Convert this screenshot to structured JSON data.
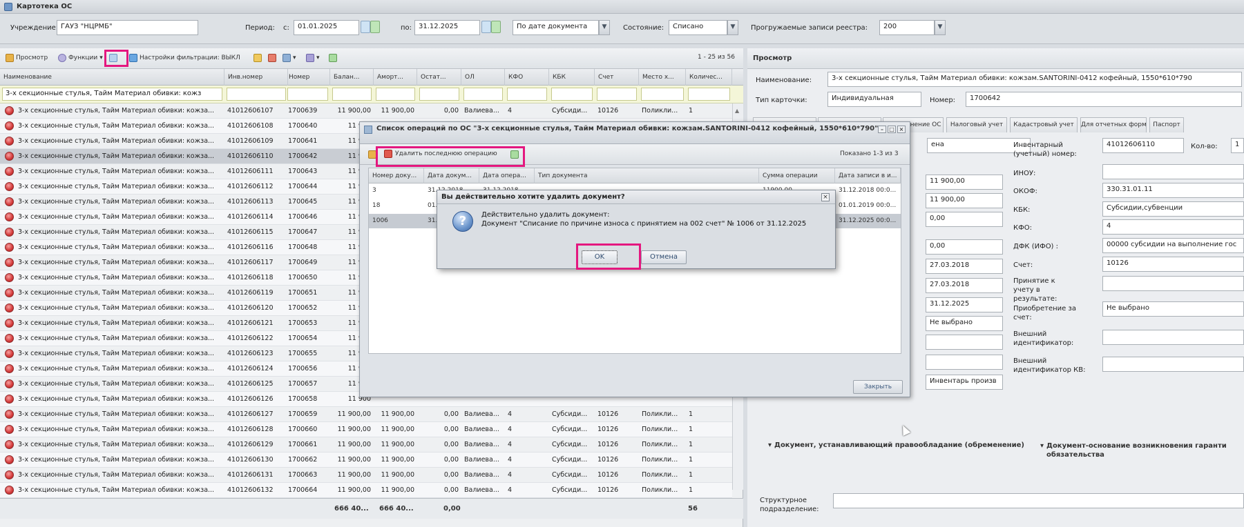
{
  "window": {
    "title": "Картотека ОС"
  },
  "filters": {
    "institution_label": "Учреждение:",
    "institution_value": "ГАУЗ \"НЦРМБ\"",
    "period_label": "Период:",
    "from_label": "с:",
    "from_value": "01.01.2025",
    "to_label": "по:",
    "to_value": "31.12.2025",
    "date_mode": "По дате документа",
    "state_label": "Состояние:",
    "state_value": "Списано",
    "loaded_label": "Прогружаемые записи реестра:",
    "loaded_value": "200"
  },
  "toolbar": {
    "view": "Просмотр",
    "functions": "Функции",
    "filter_settings": "Настройки фильтрации: ВЫКЛ",
    "pager": "1 - 25 из 56"
  },
  "columns": [
    "Наименование",
    "Инв.номер",
    "Номер",
    "Балан...",
    "Аморт...",
    "Остат...",
    "ОЛ",
    "КФО",
    "КБК",
    "Счет",
    "Место х...",
    "Количес..."
  ],
  "filter_row": {
    "name": "3-х секционные стулья, Тайм  Материал обивки: кожз"
  },
  "rows": [
    {
      "name": "3-х секционные стулья, Тайм Материал обивки: кожза...",
      "inv": "41012606107",
      "num": "1700639",
      "bal": "11 900,00",
      "amort": "11 900,00",
      "rest": "0,00",
      "ol": "Валиева...",
      "kfo": "4",
      "kbk": "Субсиди...",
      "acc": "10126",
      "place": "Поликли...",
      "qty": "1"
    },
    {
      "name": "3-х секционные стулья, Тайм Материал обивки: кожза...",
      "inv": "41012606108",
      "num": "1700640",
      "bal": "11 900"
    },
    {
      "name": "3-х секционные стулья, Тайм Материал обивки: кожза...",
      "inv": "41012606109",
      "num": "1700641",
      "bal": "11 900"
    },
    {
      "name": "3-х секционные стулья, Тайм Материал обивки: кожза...",
      "inv": "41012606110",
      "num": "1700642",
      "bal": "11 900"
    },
    {
      "name": "3-х секционные стулья, Тайм Материал обивки: кожза...",
      "inv": "41012606111",
      "num": "1700643",
      "bal": "11 900"
    },
    {
      "name": "3-х секционные стулья, Тайм Материал обивки: кожза...",
      "inv": "41012606112",
      "num": "1700644",
      "bal": "11 900"
    },
    {
      "name": "3-х секционные стулья, Тайм Материал обивки: кожза...",
      "inv": "41012606113",
      "num": "1700645",
      "bal": "11 900"
    },
    {
      "name": "3-х секционные стулья, Тайм Материал обивки: кожза...",
      "inv": "41012606114",
      "num": "1700646",
      "bal": "11 900"
    },
    {
      "name": "3-х секционные стулья, Тайм Материал обивки: кожза...",
      "inv": "41012606115",
      "num": "1700647",
      "bal": "11 900"
    },
    {
      "name": "3-х секционные стулья, Тайм Материал обивки: кожза...",
      "inv": "41012606116",
      "num": "1700648",
      "bal": "11 900"
    },
    {
      "name": "3-х секционные стулья, Тайм Материал обивки: кожза...",
      "inv": "41012606117",
      "num": "1700649",
      "bal": "11 900"
    },
    {
      "name": "3-х секционные стулья, Тайм Материал обивки: кожза...",
      "inv": "41012606118",
      "num": "1700650",
      "bal": "11 900"
    },
    {
      "name": "3-х секционные стулья, Тайм Материал обивки: кожза...",
      "inv": "41012606119",
      "num": "1700651",
      "bal": "11 900"
    },
    {
      "name": "3-х секционные стулья, Тайм Материал обивки: кожза...",
      "inv": "41012606120",
      "num": "1700652",
      "bal": "11 900"
    },
    {
      "name": "3-х секционные стулья, Тайм Материал обивки: кожза...",
      "inv": "41012606121",
      "num": "1700653",
      "bal": "11 900"
    },
    {
      "name": "3-х секционные стулья, Тайм Материал обивки: кожза...",
      "inv": "41012606122",
      "num": "1700654",
      "bal": "11 900"
    },
    {
      "name": "3-х секционные стулья, Тайм Материал обивки: кожза...",
      "inv": "41012606123",
      "num": "1700655",
      "bal": "11 900"
    },
    {
      "name": "3-х секционные стулья, Тайм Материал обивки: кожза...",
      "inv": "41012606124",
      "num": "1700656",
      "bal": "11 900"
    },
    {
      "name": "3-х секционные стулья, Тайм Материал обивки: кожза...",
      "inv": "41012606125",
      "num": "1700657",
      "bal": "11 900"
    },
    {
      "name": "3-х секционные стулья, Тайм Материал обивки: кожза...",
      "inv": "41012606126",
      "num": "1700658",
      "bal": "11 900"
    },
    {
      "name": "3-х секционные стулья, Тайм Материал обивки: кожза...",
      "inv": "41012606127",
      "num": "1700659",
      "bal": "11 900,00",
      "amort": "11 900,00",
      "rest": "0,00",
      "ol": "Валиева...",
      "kfo": "4",
      "kbk": "Субсиди...",
      "acc": "10126",
      "place": "Поликли...",
      "qty": "1"
    },
    {
      "name": "3-х секционные стулья, Тайм Материал обивки: кожза...",
      "inv": "41012606128",
      "num": "1700660",
      "bal": "11 900,00",
      "amort": "11 900,00",
      "rest": "0,00",
      "ol": "Валиева...",
      "kfo": "4",
      "kbk": "Субсиди...",
      "acc": "10126",
      "place": "Поликли...",
      "qty": "1"
    },
    {
      "name": "3-х секционные стулья, Тайм Материал обивки: кожза...",
      "inv": "41012606129",
      "num": "1700661",
      "bal": "11 900,00",
      "amort": "11 900,00",
      "rest": "0,00",
      "ol": "Валиева...",
      "kfo": "4",
      "kbk": "Субсиди...",
      "acc": "10126",
      "place": "Поликли...",
      "qty": "1"
    },
    {
      "name": "3-х секционные стулья, Тайм Материал обивки: кожза...",
      "inv": "41012606130",
      "num": "1700662",
      "bal": "11 900,00",
      "amort": "11 900,00",
      "rest": "0,00",
      "ol": "Валиева...",
      "kfo": "4",
      "kbk": "Субсиди...",
      "acc": "10126",
      "place": "Поликли...",
      "qty": "1"
    },
    {
      "name": "3-х секционные стулья, Тайм Материал обивки: кожза...",
      "inv": "41012606131",
      "num": "1700663",
      "bal": "11 900,00",
      "amort": "11 900,00",
      "rest": "0,00",
      "ol": "Валиева...",
      "kfo": "4",
      "kbk": "Субсиди...",
      "acc": "10126",
      "place": "Поликли...",
      "qty": "1"
    },
    {
      "name": "3-х секционные стулья, Тайм Материал обивки: кожза...",
      "inv": "41012606132",
      "num": "1700664",
      "bal": "11 900,00",
      "amort": "11 900,00",
      "rest": "0,00",
      "ol": "Валиева...",
      "kfo": "4",
      "kbk": "Субсиди...",
      "acc": "10126",
      "place": "Поликли...",
      "qty": "1"
    }
  ],
  "selected_row_index": 3,
  "totals": {
    "bal": "666 40...",
    "amort": "666 40...",
    "rest": "0,00",
    "qty": "56"
  },
  "view_panel": {
    "title": "Просмотр",
    "name_label": "Наименование:",
    "name_value": "3-х секционные стулья, Тайм  Материал обивки: кожзам.SANTORINI-0412 кофейный, 1550*610*790",
    "card_type_label": "Тип карточки:",
    "card_type_value": "Индивидуальная",
    "number_label": "Номер:",
    "number_value": "1700642",
    "tabs": [
      "Основное",
      "Амортизация",
      "Обременение ОС",
      "Налоговый учет",
      "Кадастровый учет",
      "Для отчетных форм",
      "Паспорт"
    ],
    "partial_value": "ена",
    "values_col": [
      "11 900,00",
      "11 900,00",
      "0,00",
      "0,00",
      "27.03.2018",
      "27.03.2018",
      "31.12.2025",
      "Не выбрано",
      "",
      "",
      "Инвентарь произв"
    ],
    "inv_label": "Инвентарный (учетный) номер:",
    "inv_value": "41012606110",
    "qty_label": "Кол-во:",
    "qty_value": "1",
    "inou_label": "ИНОУ:",
    "okof_label": "ОКОФ:",
    "okof_value": "330.31.01.11",
    "kbk_label": "КБК:",
    "kbk_value": "Субсидии,субвенции",
    "kfo_label": "КФО:",
    "kfo_value": "4",
    "dfk_label": "ДФК (ИФО) :",
    "dfk_value": "00000 субсидии на выполнение гос",
    "acc_label": "Счет:",
    "acc_value": "10126",
    "accept_label": "Принятие к учету в результате:",
    "acquire_label": "Приобретение за счет:",
    "acquire_value": "Не выбрано",
    "ext_id_label": "Внешний идентификатор:",
    "ext_id_kv_label": "Внешний идентификатор КВ:",
    "doc_right_label": "Документ, устанавливающий правообладание (обременение)",
    "doc_basis_label": "Документ-основание возникновения гаранти обязательства",
    "struct_label": "Структурное подразделение:"
  },
  "ops_window": {
    "title": "Список операций по ОС \"3-х секционные стулья, Тайм Материал обивки: кожзам.SANTORINI-0412 кофейный, 1550*610*790\"",
    "delete_last_label": "Удалить последнюю операцию",
    "shown": "Показано 1-3 из 3",
    "columns": [
      "Номер доку...",
      "Дата докум...",
      "Дата опера...",
      "Тип документа",
      "Сумма операции",
      "Дата записи в и..."
    ],
    "rows": [
      {
        "num": "3",
        "docdate": "31.12.2018",
        "opdate": "31.12.2018",
        "type": "",
        "sum": "11900,00",
        "rec": "31.12.2018 00:0..."
      },
      {
        "num": "18",
        "docdate": "01.0...",
        "opdate": "",
        "type": "",
        "sum": "",
        "rec": "01.01.2019 00:0..."
      },
      {
        "num": "1006",
        "docdate": "31.1...",
        "opdate": "",
        "type": "",
        "sum": "",
        "rec": "31.12.2025 00:0..."
      }
    ],
    "close_label": "Закрыть"
  },
  "dialog": {
    "title": "Вы действительно хотите удалить документ?",
    "line1": "Действительно удалить документ:",
    "line2": "Документ \"Списание по причине износа с принятием на 002 счет\" № 1006 от 31.12.2025",
    "ok_label": "OK",
    "cancel_label": "Отмена"
  },
  "colors": {
    "highlight": "#e4177f",
    "selected_row": "#c9cdd3",
    "filter_row": "#f4f6d8"
  }
}
